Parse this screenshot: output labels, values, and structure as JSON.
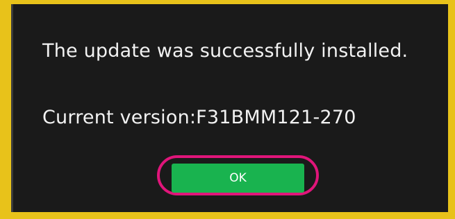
{
  "dialog": {
    "message": "The update was successfully installed.",
    "version_text": "Current version:F31BMM121-270",
    "ok_label": "OK"
  },
  "colors": {
    "frame": "#e8c21a",
    "dialog_background": "#1a1a1a",
    "ok_button": "#19b34f",
    "highlight_ring": "#e0157a"
  }
}
